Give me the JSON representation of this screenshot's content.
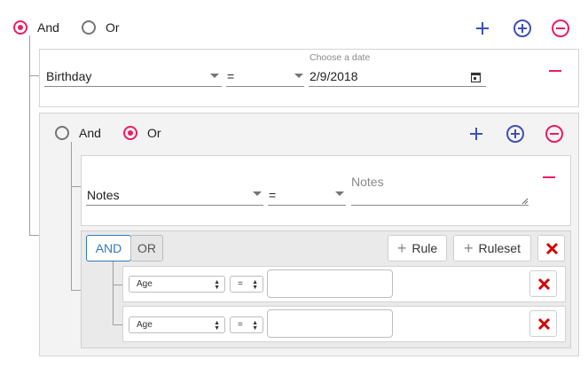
{
  "root": {
    "and_label": "And",
    "or_label": "Or",
    "selected": "and",
    "rule": {
      "field": "Birthday",
      "operator": "=",
      "date_label": "Choose a date",
      "date_value": "2/9/2018"
    },
    "group": {
      "and_label": "And",
      "or_label": "Or",
      "selected": "or",
      "rule": {
        "field": "Notes",
        "operator": "=",
        "value_placeholder": "Notes"
      },
      "subgroup": {
        "and_label": "AND",
        "or_label": "OR",
        "selected": "and",
        "add_rule_label": "Rule",
        "add_ruleset_label": "Ruleset",
        "rules": [
          {
            "field": "Age",
            "operator": "=",
            "value": ""
          },
          {
            "field": "Age",
            "operator": "=",
            "value": ""
          }
        ]
      }
    }
  },
  "colors": {
    "accent_pink": "#e91e63",
    "primary_blue": "#3f51b5",
    "danger_red": "#d50000",
    "bootstrap_blue": "#337ab7"
  },
  "icons": [
    "add-icon",
    "add-circle-icon",
    "remove-circle-icon",
    "remove-icon",
    "calendar-icon",
    "plus-icon",
    "close-icon"
  ]
}
